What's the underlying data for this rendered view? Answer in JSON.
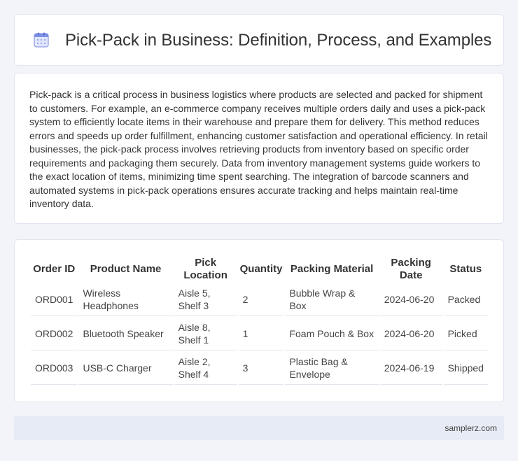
{
  "header": {
    "title": "Pick-Pack in Business: Definition, Process, and Examples",
    "icon": "calendar-icon"
  },
  "intro": {
    "text": "Pick-pack is a critical process in business logistics where products are selected and packed for shipment to customers. For example, an e-commerce company receives multiple orders daily and uses a pick-pack system to efficiently locate items in their warehouse and prepare them for delivery. This method reduces errors and speeds up order fulfillment, enhancing customer satisfaction and operational efficiency. In retail businesses, the pick-pack process involves retrieving products from inventory based on specific order requirements and packaging them securely. Data from inventory management systems guide workers to the exact location of items, minimizing time spent searching. The integration of barcode scanners and automated systems in pick-pack operations ensures accurate tracking and helps maintain real-time inventory data."
  },
  "table": {
    "headers": [
      "Order ID",
      "Product Name",
      "Pick Location",
      "Quantity",
      "Packing Material",
      "Packing Date",
      "Status"
    ],
    "rows": [
      [
        "ORD001",
        "Wireless Headphones",
        "Aisle 5, Shelf 3",
        "2",
        "Bubble Wrap & Box",
        "2024-06-20",
        "Packed"
      ],
      [
        "ORD002",
        "Bluetooth Speaker",
        "Aisle 8, Shelf 1",
        "1",
        "Foam Pouch & Box",
        "2024-06-20",
        "Picked"
      ],
      [
        "ORD003",
        "USB-C Charger",
        "Aisle 2, Shelf 4",
        "3",
        "Plastic Bag & Envelope",
        "2024-06-19",
        "Shipped"
      ]
    ]
  },
  "footer": {
    "brand": "samplerz.com"
  },
  "colors": {
    "background": "#f2f4f9",
    "icon_accent": "#6b7fe0",
    "footer_bg": "#e6ebf5"
  }
}
